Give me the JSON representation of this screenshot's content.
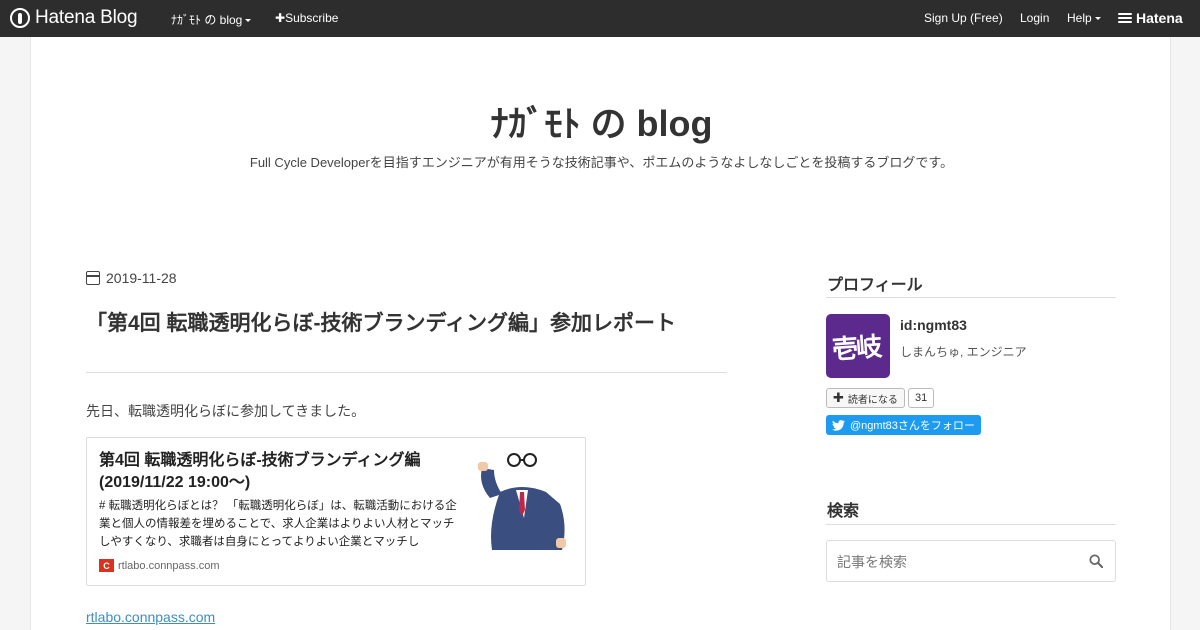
{
  "topbar": {
    "logo": "Hatena Blog",
    "blog_selector": "ﾅｶﾞﾓﾄ の blog",
    "subscribe": "Subscribe",
    "signup": "Sign Up (Free)",
    "login": "Login",
    "help": "Help",
    "brand": "Hatena"
  },
  "header": {
    "title": "ﾅｶﾞﾓﾄ の blog",
    "description": "Full Cycle Developerを目指すエンジニアが有用そうな技術記事や、ポエムのようなよしなしごとを投稿するブログです。"
  },
  "entry": {
    "date": "2019-11-28",
    "title": "「第4回 転職透明化らぼ-技術ブランディング編」参加レポート",
    "intro": "先日、転職透明化らぼに参加してきました。",
    "card": {
      "title": "第4回 転職透明化らぼ-技術ブランディング編 (2019/11/22 19:00〜)",
      "description": "# 転職透明化らぼとは？ 「転職透明化らぼ」は、転職活動における企業と個人の情報差を埋めることで、求人企業はよりよい人材とマッチしやすくなり、求職者は自身にとってよりよい企業とマッチし",
      "site": "rtlabo.connpass.com",
      "favicon": "C"
    },
    "link": "rtlabo.connpass.com"
  },
  "sidebar": {
    "profile_heading": "プロフィール",
    "avatar_text": "壱岐",
    "user_id": "id:ngmt83",
    "user_desc": "しまんちゅ, エンジニア",
    "reader_button": "読者になる",
    "reader_count": "31",
    "twitter_button": "@ngmt83さんをフォロー",
    "search_heading": "検索",
    "search_placeholder": "記事を検索"
  },
  "colors": {
    "topbar_bg": "#2d2d2d",
    "link": "#3e8ec1",
    "twitter": "#1d9bf0",
    "avatar_bg": "#5b2a8c"
  }
}
